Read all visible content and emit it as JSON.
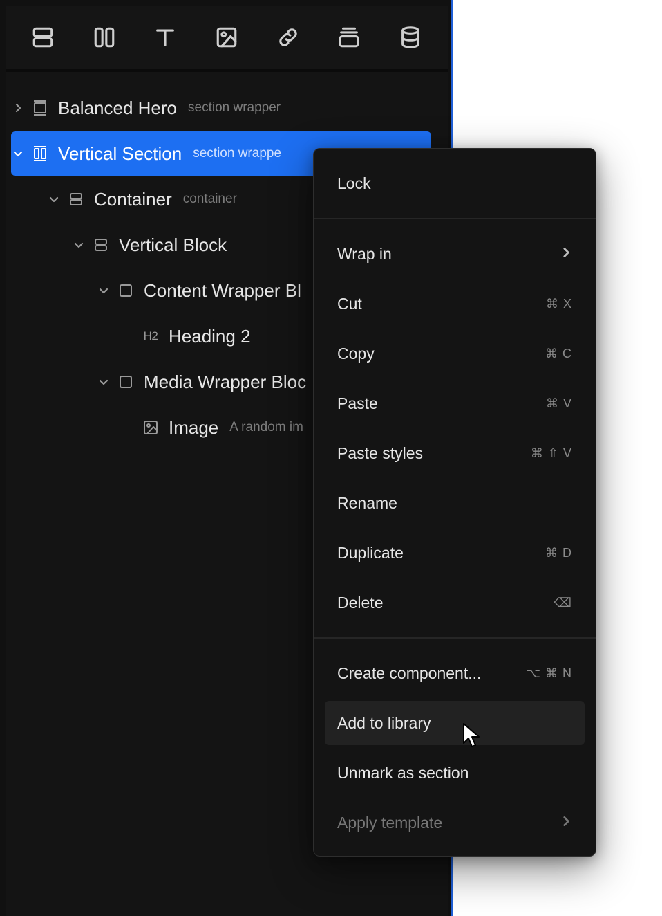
{
  "toolbar": {
    "tools": [
      {
        "icon": "section-icon"
      },
      {
        "icon": "columns-icon"
      },
      {
        "icon": "text-icon"
      },
      {
        "icon": "image-icon"
      },
      {
        "icon": "link-icon"
      },
      {
        "icon": "stack-icon"
      },
      {
        "icon": "database-icon"
      }
    ]
  },
  "navigator": {
    "items": [
      {
        "label": "Balanced Hero",
        "sub": "section wrapper",
        "icon": "section-wrapper-icon",
        "expanded": false
      },
      {
        "label": "Vertical Section",
        "sub": "section wrappe",
        "icon": "vertical-section-icon",
        "expanded": true,
        "selected": true
      },
      {
        "label": "Container",
        "sub": "container",
        "icon": "container-icon",
        "expanded": true
      },
      {
        "label": "Vertical Block",
        "sub": "",
        "icon": "vertical-block-icon",
        "expanded": true
      },
      {
        "label": "Content Wrapper Bl",
        "sub": "",
        "icon": "box-icon",
        "expanded": true
      },
      {
        "label": "Heading 2",
        "sub": "",
        "icon": "h2-icon",
        "icon_text": "H2"
      },
      {
        "label": "Media Wrapper Bloc",
        "sub": "",
        "icon": "box-icon",
        "expanded": true
      },
      {
        "label": "Image",
        "sub": "A random im",
        "icon": "image-icon"
      }
    ]
  },
  "context_menu": {
    "items": [
      {
        "label": "Lock",
        "shortcut": ""
      },
      {
        "label": "Wrap in",
        "submenu": true
      },
      {
        "label": "Cut",
        "shortcut": "⌘ X"
      },
      {
        "label": "Copy",
        "shortcut": "⌘ C"
      },
      {
        "label": "Paste",
        "shortcut": "⌘ V"
      },
      {
        "label": "Paste styles",
        "shortcut": "⌘ ⇧ V"
      },
      {
        "label": "Rename",
        "shortcut": ""
      },
      {
        "label": "Duplicate",
        "shortcut": "⌘ D"
      },
      {
        "label": "Delete",
        "shortcut": "⌫"
      },
      {
        "label": "Create component...",
        "shortcut": "⌥ ⌘ N"
      },
      {
        "label": "Add to library",
        "shortcut": "",
        "hovered": true
      },
      {
        "label": "Unmark as section",
        "shortcut": ""
      },
      {
        "label": "Apply template",
        "submenu": true,
        "disabled": true
      }
    ]
  }
}
